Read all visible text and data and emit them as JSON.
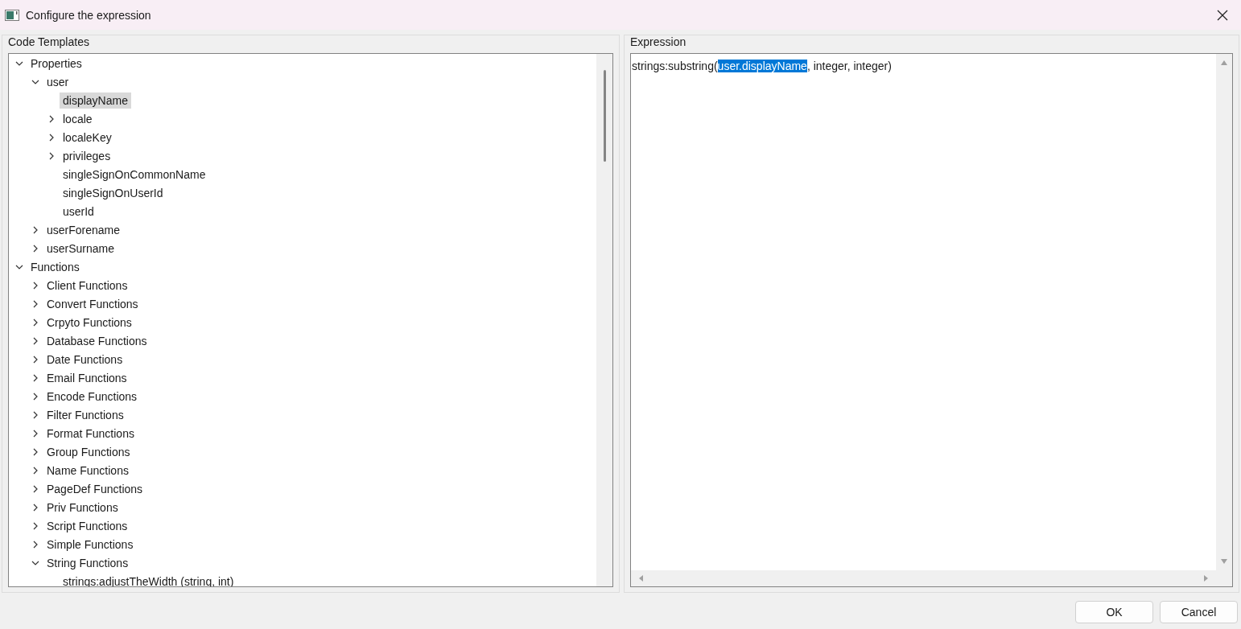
{
  "window": {
    "title": "Configure the expression"
  },
  "code_templates": {
    "title": "Code Templates",
    "tree": [
      {
        "label": "Properties",
        "expanded": true,
        "selected": false,
        "children": [
          {
            "label": "user",
            "expanded": true,
            "selected": false,
            "children": [
              {
                "label": "displayName",
                "selected": true
              },
              {
                "label": "locale",
                "expanded": false,
                "selected": false
              },
              {
                "label": "localeKey",
                "expanded": false,
                "selected": false
              },
              {
                "label": "privileges",
                "expanded": false,
                "selected": false
              },
              {
                "label": "singleSignOnCommonName",
                "selected": false
              },
              {
                "label": "singleSignOnUserId",
                "selected": false
              },
              {
                "label": "userId",
                "selected": false
              }
            ]
          },
          {
            "label": "userForename",
            "expanded": false,
            "selected": false
          },
          {
            "label": "userSurname",
            "expanded": false,
            "selected": false
          }
        ]
      },
      {
        "label": "Functions",
        "expanded": true,
        "selected": false,
        "children": [
          {
            "label": "Client Functions",
            "expanded": false,
            "selected": false
          },
          {
            "label": "Convert Functions",
            "expanded": false,
            "selected": false
          },
          {
            "label": "Crpyto Functions",
            "expanded": false,
            "selected": false
          },
          {
            "label": "Database Functions",
            "expanded": false,
            "selected": false
          },
          {
            "label": "Date Functions",
            "expanded": false,
            "selected": false
          },
          {
            "label": "Email Functions",
            "expanded": false,
            "selected": false
          },
          {
            "label": "Encode Functions",
            "expanded": false,
            "selected": false
          },
          {
            "label": "Filter Functions",
            "expanded": false,
            "selected": false
          },
          {
            "label": "Format Functions",
            "expanded": false,
            "selected": false
          },
          {
            "label": "Group Functions",
            "expanded": false,
            "selected": false
          },
          {
            "label": "Name Functions",
            "expanded": false,
            "selected": false
          },
          {
            "label": "PageDef Functions",
            "expanded": false,
            "selected": false
          },
          {
            "label": "Priv Functions",
            "expanded": false,
            "selected": false
          },
          {
            "label": "Script Functions",
            "expanded": false,
            "selected": false
          },
          {
            "label": "Simple Functions",
            "expanded": false,
            "selected": false
          },
          {
            "label": "String Functions",
            "expanded": true,
            "selected": false,
            "children": [
              {
                "label": "strings:adjustTheWidth (string, int)",
                "selected": false
              }
            ]
          }
        ]
      }
    ]
  },
  "expression": {
    "title": "Expression",
    "before": "strings:substring(",
    "selection": "user.displayName",
    "after": ", integer, integer)"
  },
  "buttons": [
    {
      "label": "OK"
    },
    {
      "label": "Cancel"
    }
  ]
}
